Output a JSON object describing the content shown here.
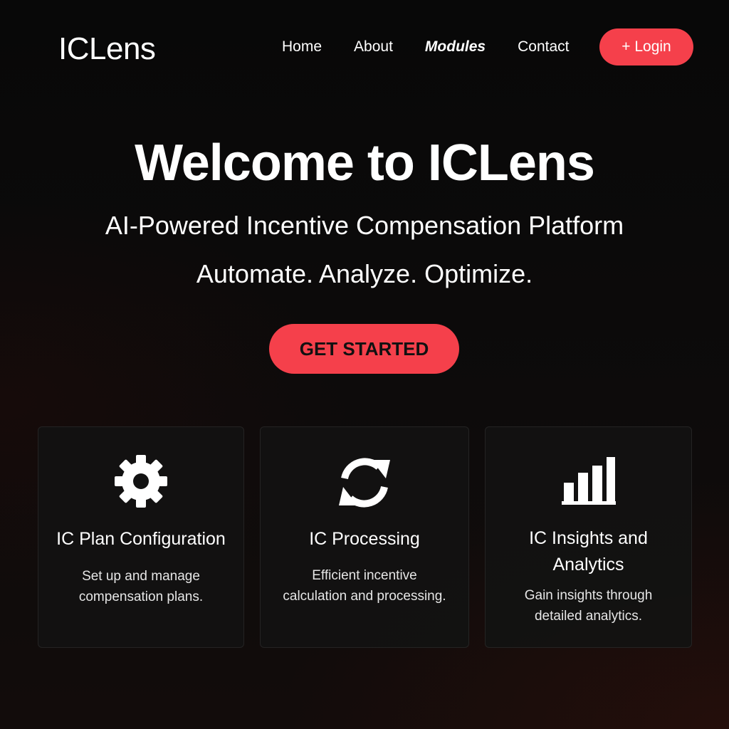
{
  "header": {
    "logo": "ICLens",
    "nav": [
      {
        "label": "Home",
        "active": false
      },
      {
        "label": "About",
        "active": false
      },
      {
        "label": "Modules",
        "active": true
      },
      {
        "label": "Contact",
        "active": false
      }
    ],
    "login_label": "+ Login"
  },
  "hero": {
    "title": "Welcome to ICLens",
    "subtitle": "AI-Powered Incentive Compensation Platform",
    "tagline": "Automate. Analyze. Optimize.",
    "cta_label": "GET STARTED"
  },
  "cards": [
    {
      "icon": "gear-icon",
      "title": "IC Plan Configuration",
      "description": "Set up and manage compensation plans."
    },
    {
      "icon": "refresh-icon",
      "title": "IC Processing",
      "description": "Efficient incentive calculation and processing."
    },
    {
      "icon": "bar-chart-icon",
      "title": "IC Insights and Analytics",
      "description": "Gain insights through detailed analytics."
    }
  ],
  "colors": {
    "accent": "#f5404b",
    "background": "#0a0a0a",
    "card_background": "#121212",
    "text": "#ffffff"
  }
}
